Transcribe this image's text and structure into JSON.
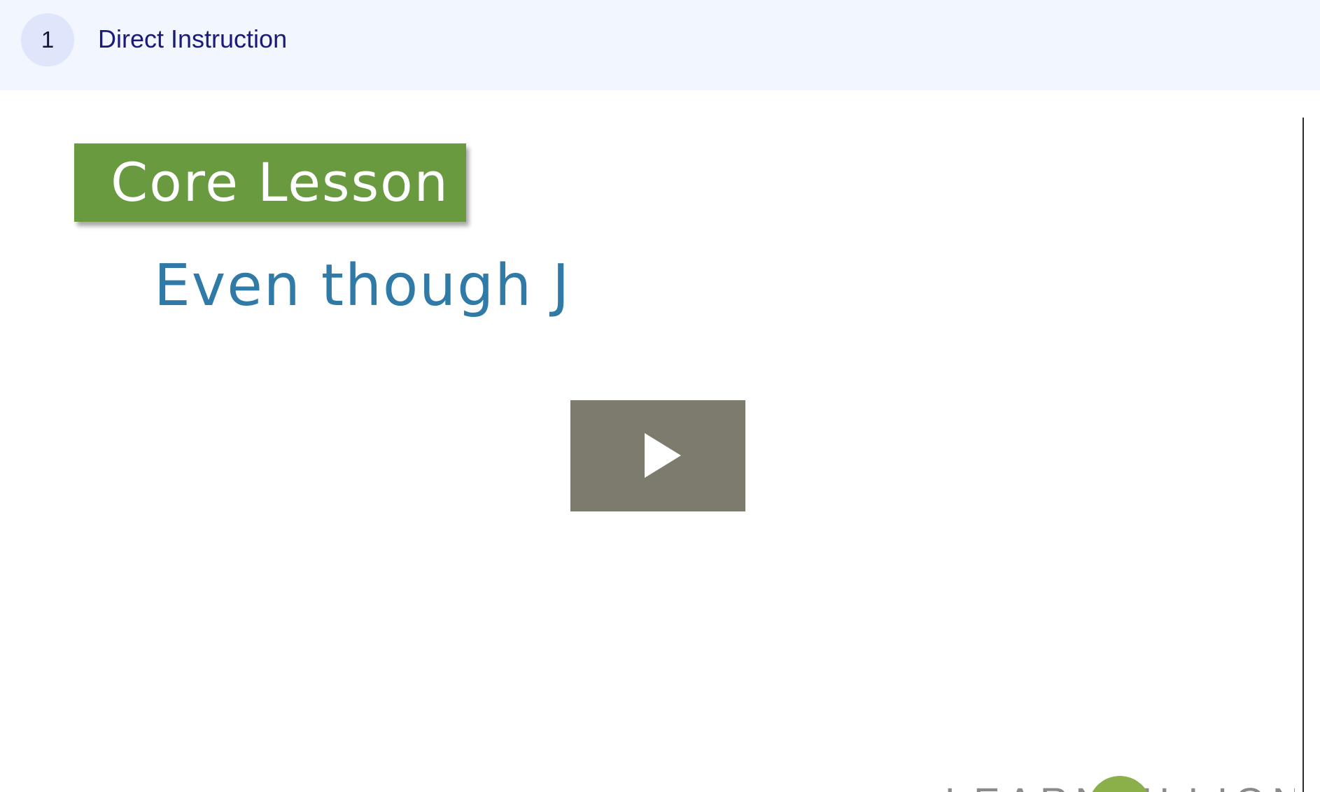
{
  "step": {
    "number": "1",
    "title": "Direct Instruction"
  },
  "video": {
    "banner_label": "Core Lesson",
    "lesson_text": "Even though J",
    "play_icon": "play-icon",
    "watermark": "LEARNZILLION"
  },
  "colors": {
    "header_bg": "#f2f6fe",
    "badge_bg": "#dfe5fb",
    "title_color": "#1a1a7a",
    "banner_bg": "#6a9a40",
    "lesson_text_color": "#2f7aa6",
    "play_button_bg": "#7c7b6d"
  }
}
